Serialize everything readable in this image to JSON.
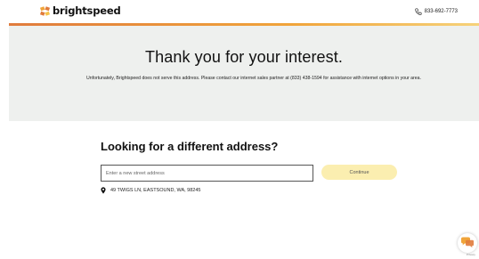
{
  "brand": {
    "name": "brightspeed",
    "accent": "#f0a43a",
    "logo_icon": "brightspeed-star-icon"
  },
  "header": {
    "phone": "833-692-7773",
    "phone_icon": "phone-icon"
  },
  "hero": {
    "title": "Thank you for your interest.",
    "message": "Unfortunately, Brightspeed does not serve this address. Please contact our internet sales partner at (833) 438-1594 for assistance with internet options in your area."
  },
  "lookup": {
    "title": "Looking for a different address?",
    "input_placeholder": "Enter a new street address",
    "continue_label": "Continue",
    "current_address": "49 TWIGS LN, EASTSOUND, WA, 98245"
  },
  "chat": {
    "icon": "chat-bubbles-icon",
    "label": "Privacy"
  },
  "colors": {
    "hero_bg": "#eef0ee",
    "button_bg": "#fbeeb0",
    "bar_start": "#e07b3c",
    "bar_end": "#f6d27a"
  }
}
